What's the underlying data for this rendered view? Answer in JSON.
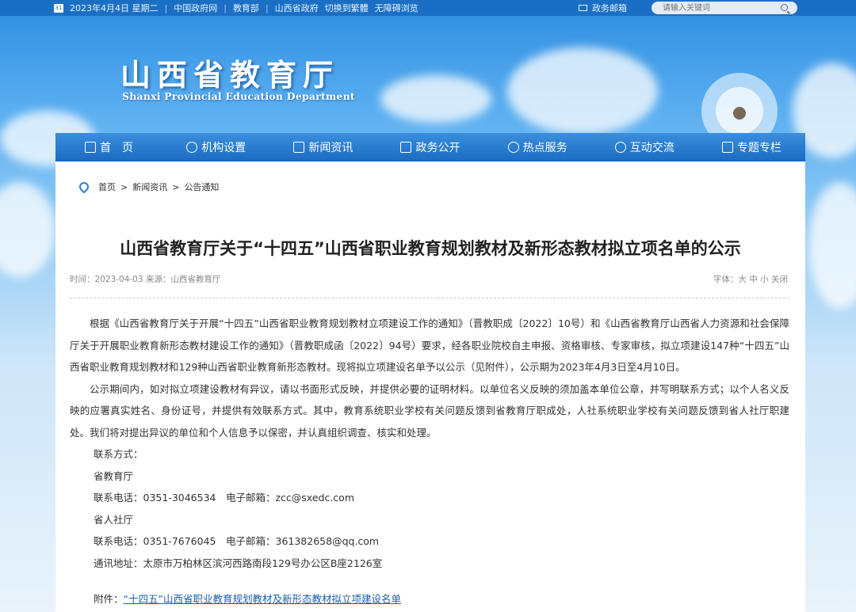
{
  "topbar": {
    "calendar_day": "31",
    "date": "2023年4月4日 星期二",
    "links": [
      "中国政府网",
      "教育部",
      "山西省政府",
      "切换到繁體",
      "无障碍浏览"
    ],
    "mail_label": "政务邮箱",
    "search_placeholder": "请输入关键词"
  },
  "header": {
    "title_cn": "山西省教育厅",
    "title_en": "Shanxi Provincial Education Department"
  },
  "nav": {
    "items": [
      {
        "label": "首　页",
        "icon": "home-icon"
      },
      {
        "label": "机构设置",
        "icon": "org-icon"
      },
      {
        "label": "新闻资讯",
        "icon": "news-icon"
      },
      {
        "label": "政务公开",
        "icon": "gov-icon"
      },
      {
        "label": "热点服务",
        "icon": "service-icon"
      },
      {
        "label": "互动交流",
        "icon": "interact-icon"
      },
      {
        "label": "专题专栏",
        "icon": "topic-icon"
      }
    ]
  },
  "breadcrumb": {
    "items": [
      "首页",
      "新闻资讯",
      "公告通知"
    ],
    "separator": ">"
  },
  "article": {
    "title": "山西省教育厅关于“十四五”山西省职业教育规划教材及新形态教材拟立项名单的公示",
    "meta": "时间：2023-04-03  来源：山西省教育厅",
    "font_controls": "字体：大 中 小 关闭",
    "paragraphs": [
      "根据《山西省教育厅关于开展“十四五”山西省职业教育规划教材立项建设工作的通知》（晋教职成〔2022〕10号）和《山西省教育厅山西省人力资源和社会保障厅关于开展职业教育新形态教材建设工作的通知》（晋教职成函〔2022〕94号）要求，经各职业院校自主申报、资格审核、专家审核，拟立项建设147种“十四五”山西省职业教育规划教材和129种山西省职业教育新形态教材。现将拟立项建设名单予以公示（见附件），公示期为2023年4月3日至4月10日。",
      "公示期间内，如对拟立项建设教材有异议，请以书面形式反映，并提供必要的证明材料。以单位名义反映的须加盖本单位公章，并写明联系方式；以个人名义反映的应署真实姓名、身份证号，并提供有效联系方式。其中，教育系统职业学校有关问题反馈到省教育厅职成处，人社系统职业学校有关问题反馈到省人社厅职建处。我们将对提出异议的单位和个人信息予以保密，并认真组织调查、核实和处理。"
    ],
    "contact_lines": [
      "联系方式：",
      "省教育厅",
      "联系电话：0351-3046534　电子邮箱：zcc@sxedc.com",
      "省人社厅",
      "联系电话：0351-7676045　电子邮箱：361382658@qq.com",
      "通讯地址：太原市万柏林区滨河西路南段129号办公区B座2126室"
    ],
    "attachment_label": "附件：",
    "attachment_link": "“十四五”山西省职业教育规划教材及新形态教材拟立项建设名单"
  }
}
